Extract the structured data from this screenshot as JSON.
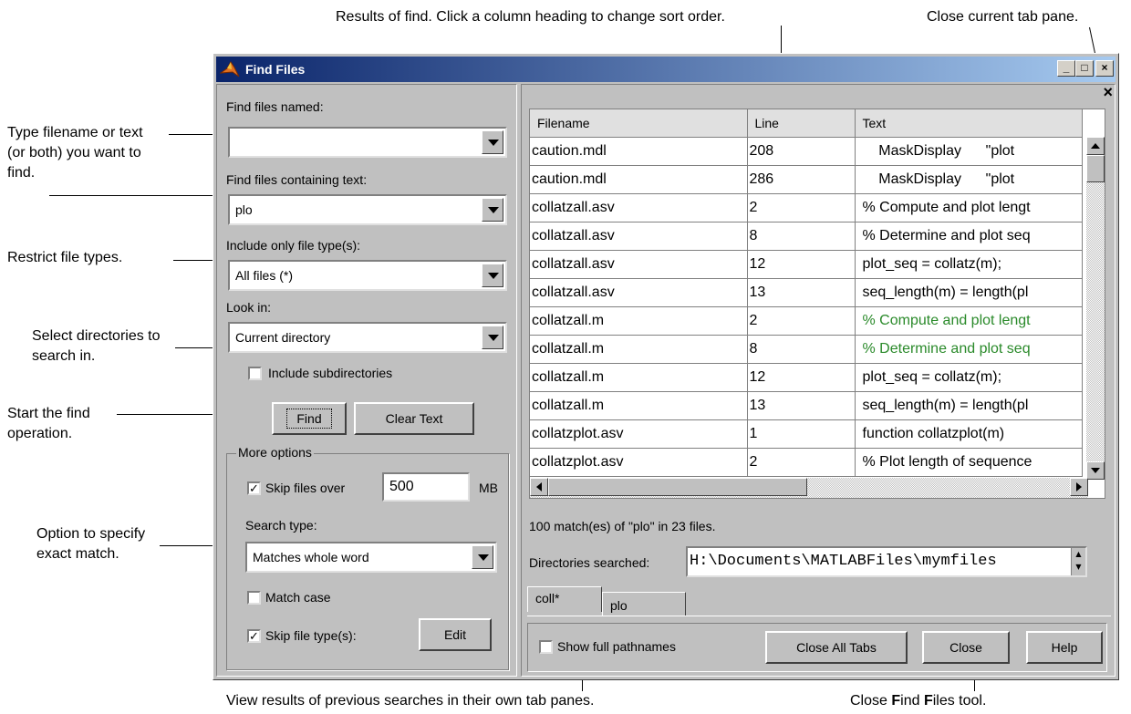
{
  "annotations": {
    "results": "Results of find. Click a column heading to change sort order.",
    "close_tab": "Close current tab pane.",
    "type_filename_1": "Type filename or text",
    "type_filename_2": "(or both) you want to",
    "type_filename_3": "find.",
    "restrict": "Restrict file types.",
    "select_dirs_1": "Select directories to",
    "select_dirs_2": "search in.",
    "start_find_1": "Start the find",
    "start_find_2": "operation.",
    "option_exact_1": "Option to specify",
    "option_exact_2": "exact match.",
    "view_results": "View results of previous searches in their own tab panes.",
    "close_tool_prefix": "Close ",
    "close_tool_f1": "F",
    "close_tool_mid": "ind ",
    "close_tool_f2": "F",
    "close_tool_suffix": "iles tool."
  },
  "window": {
    "title": "Find Files",
    "minimize": "_",
    "maximize": "□",
    "close": "×"
  },
  "left": {
    "find_named_label": "Find files named:",
    "find_named_value": "",
    "containing_label": "Find files containing text:",
    "containing_value": "plo",
    "filetype_label": "Include only file type(s):",
    "filetype_value": "All files (*)",
    "lookin_label": "Look in:",
    "lookin_value": "Current directory",
    "include_subdirs": "Include subdirectories",
    "find_button": "Find",
    "clear_button": "Clear Text",
    "more_options": "More options",
    "skip_over_label": "Skip files over",
    "skip_over_value": "500",
    "skip_over_unit": "MB",
    "search_type_label": "Search type:",
    "search_type_value": "Matches whole word",
    "match_case": "Match case",
    "skip_types": "Skip file type(s):",
    "edit_button": "Edit",
    "check_mark": "✓"
  },
  "results": {
    "columns": [
      "Filename",
      "Line",
      "Text"
    ],
    "rows": [
      {
        "file": "caution.mdl",
        "line": "208",
        "text": "    MaskDisplay      \"plot"
      },
      {
        "file": "caution.mdl",
        "line": "286",
        "text": "    MaskDisplay      \"plot"
      },
      {
        "file": "collatzall.asv",
        "line": "2",
        "text": "% Compute and plot lengt"
      },
      {
        "file": "collatzall.asv",
        "line": "8",
        "text": "% Determine and plot seq"
      },
      {
        "file": "collatzall.asv",
        "line": "12",
        "text": "plot_seq = collatz(m);"
      },
      {
        "file": "collatzall.asv",
        "line": "13",
        "text": "seq_length(m) = length(pl"
      },
      {
        "file": "collatzall.m",
        "line": "2",
        "text": "% Compute and plot lengt"
      },
      {
        "file": "collatzall.m",
        "line": "8",
        "text": "% Determine and plot seq"
      },
      {
        "file": "collatzall.m",
        "line": "12",
        "text": "plot_seq = collatz(m);"
      },
      {
        "file": "collatzall.m",
        "line": "13",
        "text": "seq_length(m) = length(pl"
      },
      {
        "file": "collatzplot.asv",
        "line": "1",
        "text": "function collatzplot(m)"
      },
      {
        "file": "collatzplot.asv",
        "line": "2",
        "text": "% Plot length of sequence"
      }
    ],
    "summary": "100 match(es) of \"plo\" in 23 files.",
    "dirs_label": "Directories searched:",
    "dirs_value": "H:\\Documents\\MATLABFiles\\mymfiles",
    "tabs": [
      "coll*",
      "plo"
    ],
    "show_full": "Show full pathnames",
    "close_all": "Close All Tabs",
    "close": "Close",
    "help": "Help",
    "pane_close": "×"
  },
  "colors": {
    "title_gradient_start": "#0a246a",
    "comment_green": "#2a8a2a"
  }
}
